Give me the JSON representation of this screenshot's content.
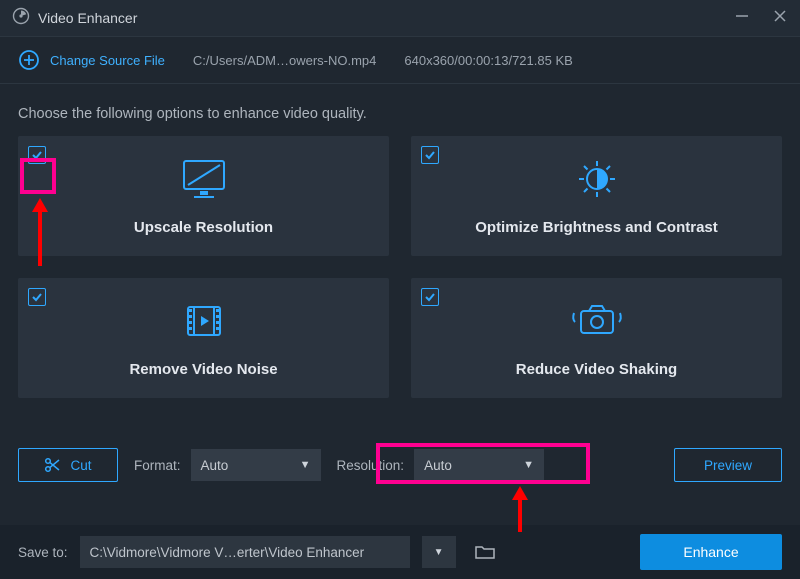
{
  "titlebar": {
    "title": "Video Enhancer"
  },
  "source": {
    "change_label": "Change Source File",
    "path": "C:/Users/ADM…owers-NO.mp4",
    "info": "640x360/00:00:13/721.85 KB"
  },
  "instruction": "Choose the following options to enhance video quality.",
  "cards": {
    "upscale": {
      "label": "Upscale Resolution",
      "checked": true
    },
    "optimize": {
      "label": "Optimize Brightness and Contrast",
      "checked": true
    },
    "denoise": {
      "label": "Remove Video Noise",
      "checked": true
    },
    "deshake": {
      "label": "Reduce Video Shaking",
      "checked": true
    }
  },
  "controls": {
    "cut_label": "Cut",
    "format_label": "Format:",
    "format_value": "Auto",
    "resolution_label": "Resolution:",
    "resolution_value": "Auto",
    "preview_label": "Preview"
  },
  "bottom": {
    "save_label": "Save to:",
    "save_path": "C:\\Vidmore\\Vidmore V…erter\\Video Enhancer",
    "enhance_label": "Enhance"
  }
}
